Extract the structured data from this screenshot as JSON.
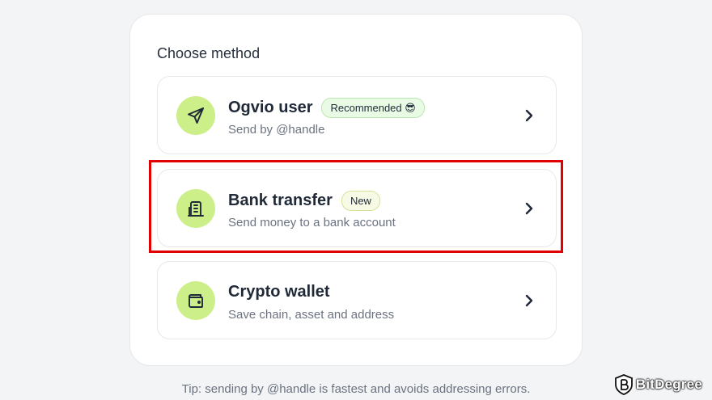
{
  "heading": "Choose method",
  "methods": [
    {
      "title": "Ogvio user",
      "badge": "Recommended 😎",
      "subtitle": "Send by @handle",
      "icon": "send-arrow-icon"
    },
    {
      "title": "Bank transfer",
      "badge": "New",
      "subtitle": "Send money to a bank account",
      "icon": "building-icon"
    },
    {
      "title": "Crypto wallet",
      "badge": "",
      "subtitle": "Save chain, asset and address",
      "icon": "wallet-icon"
    }
  ],
  "tip": "Tip: sending by @handle is fastest and avoids addressing errors.",
  "watermark": "BitDegree",
  "colors": {
    "icon_bg": "#cdef89",
    "highlight": "#e00000",
    "recommended_badge_bg": "#eafbe5",
    "new_badge_bg": "#f7fbe6"
  }
}
